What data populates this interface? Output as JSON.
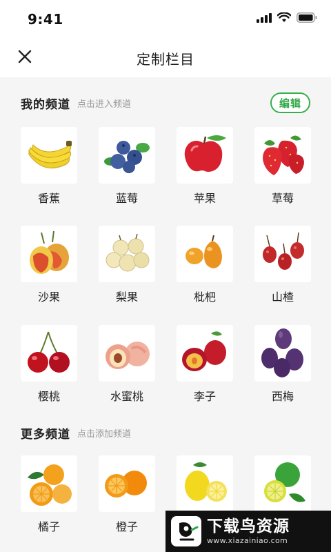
{
  "status_bar": {
    "time": "9:41"
  },
  "nav": {
    "title": "定制栏目"
  },
  "my_channels": {
    "title": "我的频道",
    "hint": "点击进入频道",
    "edit_label": "编辑",
    "items": [
      {
        "label": "香蕉",
        "icon": "banana-icon"
      },
      {
        "label": "蓝莓",
        "icon": "blueberry-icon"
      },
      {
        "label": "苹果",
        "icon": "apple-icon"
      },
      {
        "label": "草莓",
        "icon": "strawberry-icon"
      },
      {
        "label": "沙果",
        "icon": "crabapple-icon"
      },
      {
        "label": "梨果",
        "icon": "pear-icon"
      },
      {
        "label": "枇杷",
        "icon": "loquat-icon"
      },
      {
        "label": "山楂",
        "icon": "hawthorn-icon"
      },
      {
        "label": "樱桃",
        "icon": "cherry-icon"
      },
      {
        "label": "水蜜桃",
        "icon": "peach-icon"
      },
      {
        "label": "李子",
        "icon": "plum-icon"
      },
      {
        "label": "西梅",
        "icon": "prune-icon"
      }
    ]
  },
  "more_channels": {
    "title": "更多频道",
    "hint": "点击添加频道",
    "items": [
      {
        "label": "橘子",
        "icon": "tangerine-icon"
      },
      {
        "label": "橙子",
        "icon": "orange-icon"
      },
      {
        "label": "",
        "icon": "lemon-icon"
      },
      {
        "label": "",
        "icon": "lime-icon"
      }
    ]
  },
  "watermark": {
    "name": "下载鸟资源",
    "url": "www.xiazainiao.com"
  },
  "colors": {
    "accent": "#34b04a",
    "background": "#f5f5f5"
  }
}
